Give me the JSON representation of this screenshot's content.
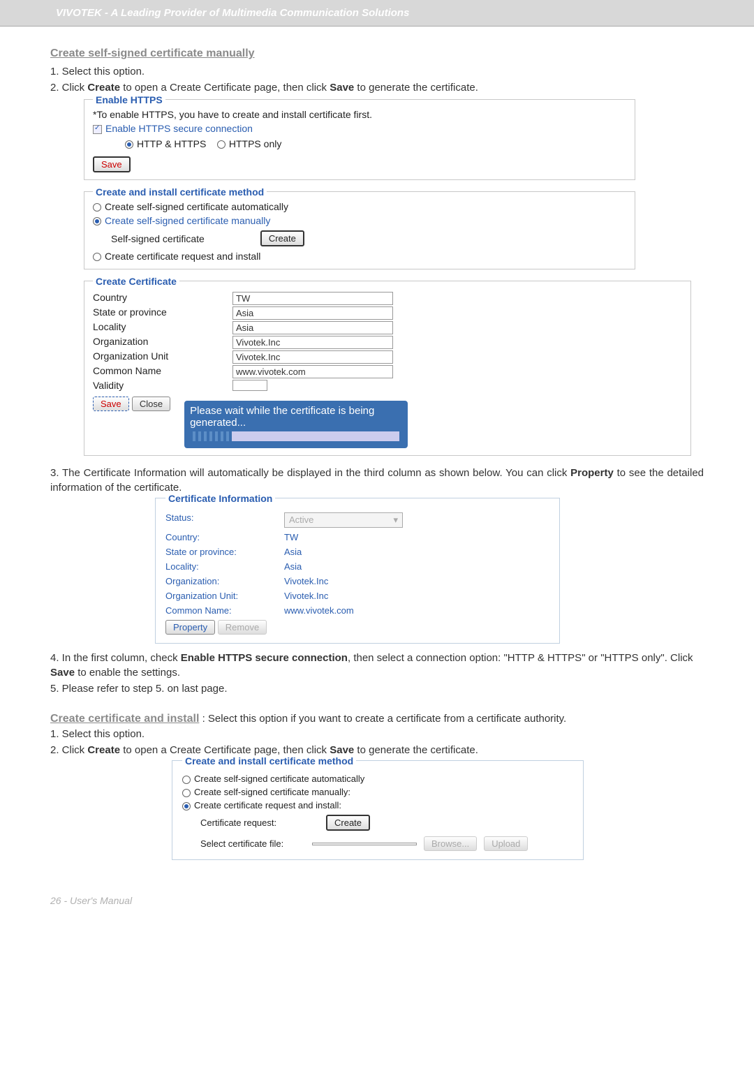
{
  "header": "VIVOTEK - A Leading Provider of Multimedia Communication Solutions",
  "section1": {
    "title": "Create self-signed certificate manually",
    "step1": "1. Select this option.",
    "step2_a": "2. Click ",
    "step2_b": "Create",
    "step2_c": " to open a Create Certificate page, then click ",
    "step2_d": "Save",
    "step2_e": " to generate the certificate."
  },
  "enable_https": {
    "legend": "Enable HTTPS",
    "note": "*To enable HTTPS, you have to create and install certificate first.",
    "checkbox_label": "Enable HTTPS secure connection",
    "radio_http_https": "HTTP & HTTPS",
    "radio_https_only": "HTTPS only",
    "save": "Save"
  },
  "install_method": {
    "legend": "Create and install certificate method",
    "opt1": "Create self-signed certificate automatically",
    "opt2": "Create self-signed certificate manually",
    "self_signed_label": "Self-signed certificate",
    "create_btn": "Create",
    "opt3": "Create certificate request and install"
  },
  "create_cert": {
    "legend": "Create Certificate",
    "country_l": "Country",
    "country_v": "TW",
    "state_l": "State or province",
    "state_v": "Asia",
    "locality_l": "Locality",
    "locality_v": "Asia",
    "org_l": "Organization",
    "org_v": "Vivotek.Inc",
    "orgunit_l": "Organization Unit",
    "orgunit_v": "Vivotek.Inc",
    "cn_l": "Common Name",
    "cn_v": "www.vivotek.com",
    "validity_l": "Validity",
    "validity_v": "",
    "save": "Save",
    "close": "Close",
    "toast": "Please wait while the certificate is being generated..."
  },
  "para3": "3. The Certificate Information will automatically be displayed in the third column as shown below. You can click Property to see the detailed information of the certificate.",
  "cert_info": {
    "legend": "Certificate Information",
    "status_l": "Status:",
    "status_v": "Active",
    "country_l": "Country:",
    "country_v": "TW",
    "state_l": "State or province:",
    "state_v": "Asia",
    "locality_l": "Locality:",
    "locality_v": "Asia",
    "org_l": "Organization:",
    "org_v": "Vivotek.Inc",
    "orgunit_l": "Organization Unit:",
    "orgunit_v": "Vivotek.Inc",
    "cn_l": "Common Name:",
    "cn_v": "www.vivotek.com",
    "property": "Property",
    "remove": "Remove"
  },
  "step4": "4. In the first column, check Enable HTTPS secure connection, then select a connection option: \"HTTP & HTTPS\" or \"HTTPS only\". Click Save to enable the settings.",
  "step5": "5. Please refer to step 5. on last page.",
  "section2": {
    "title": "Create certificate and install",
    "desc": " : Select this option if you want to create a certificate from a certificate authority.",
    "step1": "1. Select this option.",
    "step2_a": "2. Click ",
    "step2_b": "Create",
    "step2_c": " to open a Create Certificate page, then click ",
    "step2_d": "Save",
    "step2_e": " to generate the certificate."
  },
  "method2": {
    "legend": "Create and install certificate method",
    "opt1": "Create self-signed certificate automatically",
    "opt2": "Create self-signed certificate manually:",
    "opt3": "Create certificate request and install:",
    "req_l": "Certificate request:",
    "create_btn": "Create",
    "file_l": "Select certificate file:",
    "browse": "Browse...",
    "upload": "Upload"
  },
  "footer": "26 - User's Manual"
}
